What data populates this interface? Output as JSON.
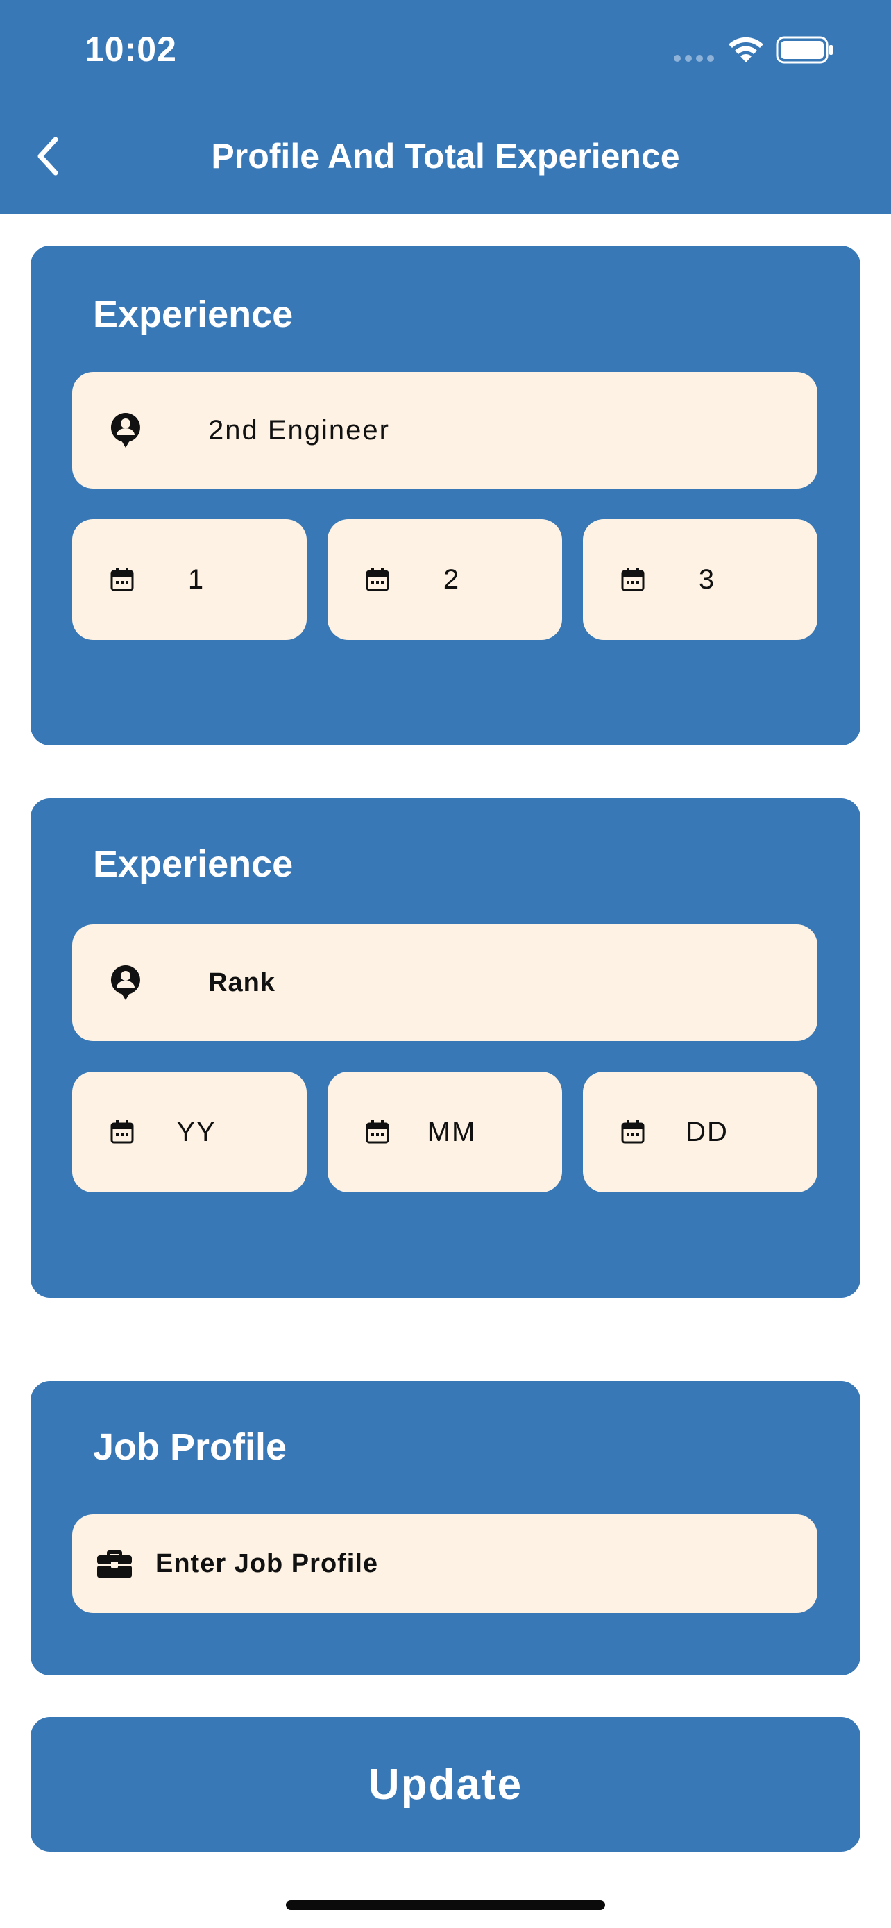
{
  "status_bar": {
    "time": "10:02"
  },
  "header": {
    "title": "Profile And Total Experience",
    "back_icon": "chevron-left-icon"
  },
  "experience_1": {
    "title": "Experience",
    "rank_value": "2nd Engineer",
    "years_value": "1",
    "months_value": "2",
    "days_value": "3"
  },
  "experience_2": {
    "title": "Experience",
    "rank_placeholder": "Rank",
    "years_placeholder": "YY",
    "months_placeholder": "MM",
    "days_placeholder": "DD"
  },
  "job_profile": {
    "title": "Job Profile",
    "placeholder": "Enter Job Profile"
  },
  "update_label": "Update",
  "colors": {
    "primary": "#3878b7",
    "field_bg": "#fdf2e3",
    "text": "#111111"
  }
}
